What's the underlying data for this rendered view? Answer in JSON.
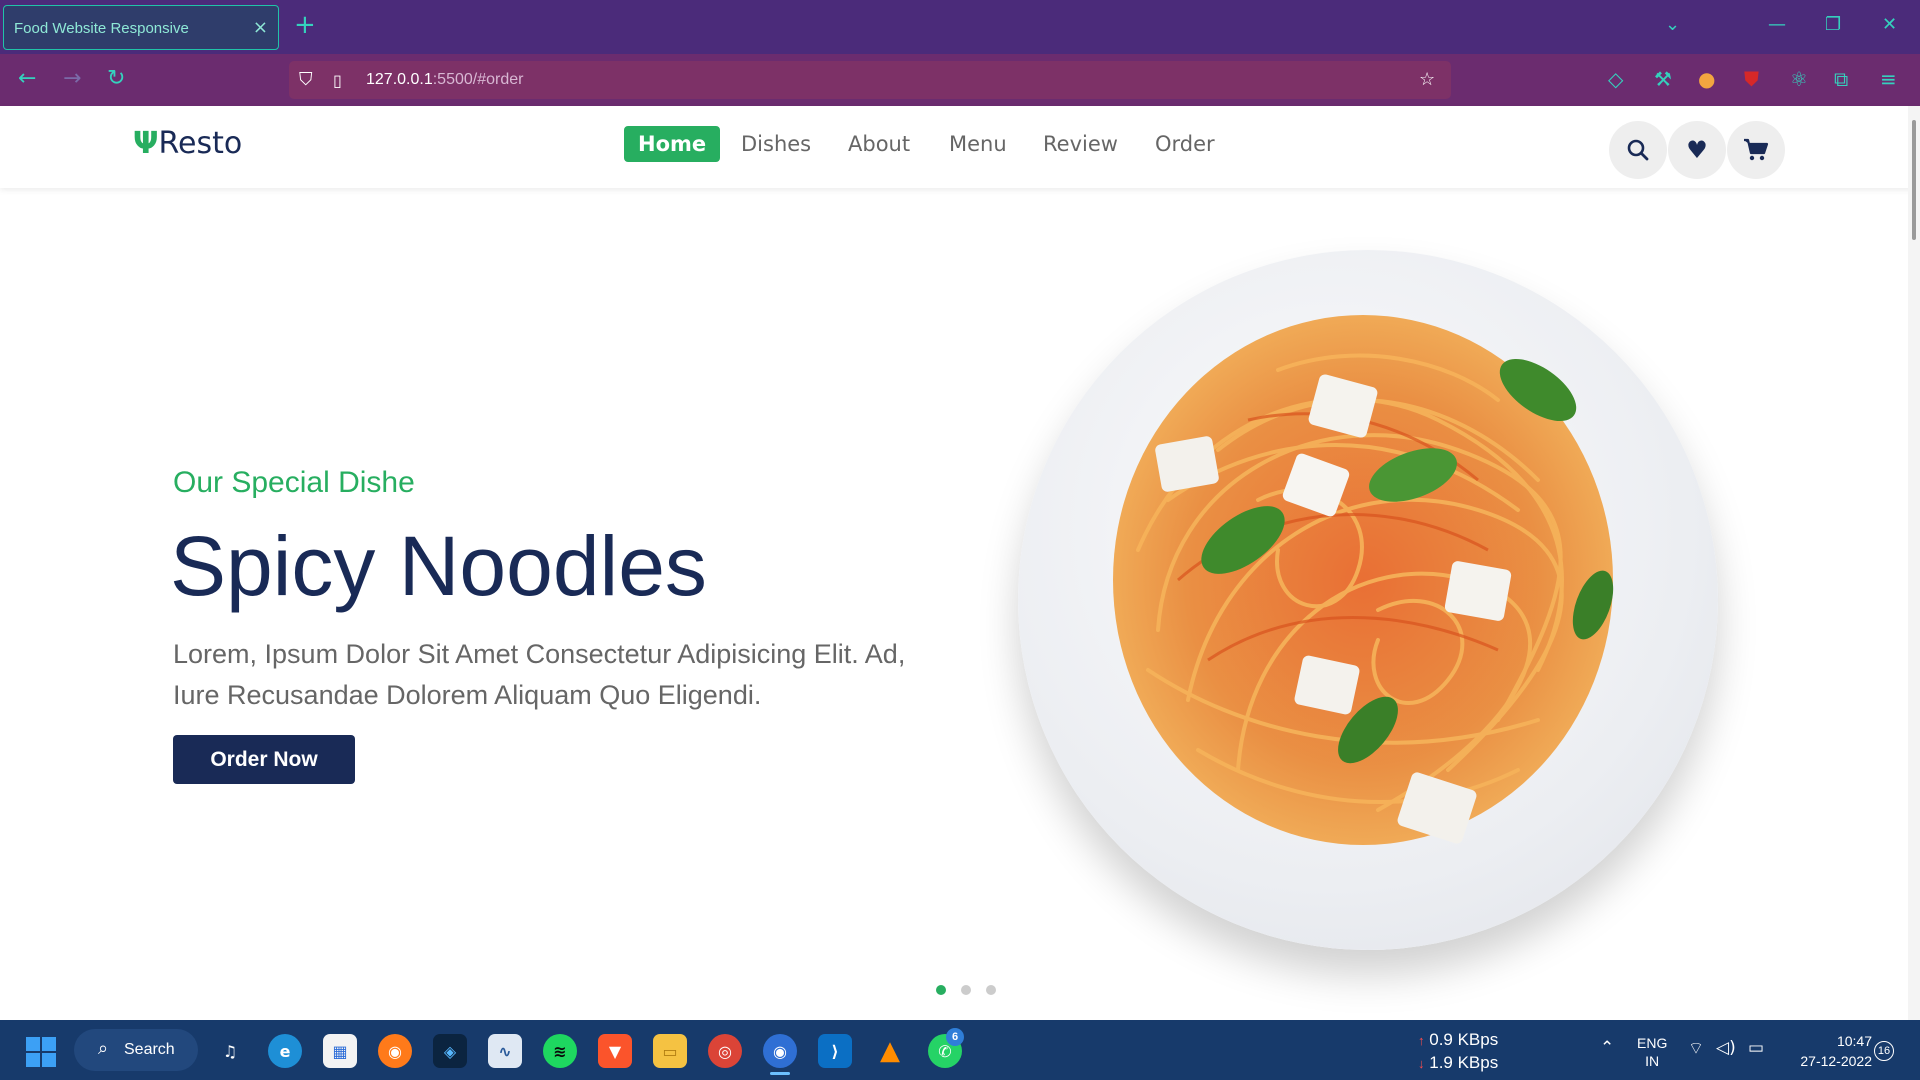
{
  "browser": {
    "tab_title": "Food Website Responsive",
    "tab_close": "×",
    "new_tab": "+",
    "url_host": "127.0.0.1",
    "url_rest": ":5500/#order",
    "window_controls": [
      "⌄",
      "—",
      "❐",
      "✕"
    ]
  },
  "site": {
    "logo_icon": "fork-knife-icon",
    "logo_text": "Resto",
    "nav": [
      {
        "label": "Home",
        "active": true
      },
      {
        "label": "Dishes",
        "active": false
      },
      {
        "label": "About",
        "active": false
      },
      {
        "label": "Menu",
        "active": false
      },
      {
        "label": "Review",
        "active": false
      },
      {
        "label": "Order",
        "active": false
      }
    ],
    "icons": [
      "search-icon",
      "heart-icon",
      "cart-icon"
    ]
  },
  "hero": {
    "subtitle": "Our Special Dishe",
    "title": "Spicy Noodles",
    "text_line1": "Lorem, Ipsum Dolor Sit Amet Consectetur Adipisicing Elit. Ad,",
    "text_line2": "Iure Recusandae Dolorem Aliquam Quo Eligendi.",
    "button": "Order Now",
    "slide_count": 3,
    "active_slide": 1
  },
  "taskbar": {
    "search_label": "Search",
    "apps": [
      "music-icon",
      "edge-icon",
      "store-icon",
      "firefox-icon",
      "dev-icon",
      "monitor-icon",
      "spotify-icon",
      "brave-icon",
      "folder-icon",
      "chrome-icon",
      "firefox-dev-icon",
      "vscode-icon",
      "vlc-icon",
      "whatsapp-icon"
    ],
    "whatsapp_badge": "6",
    "net_up": "0.9 KBps",
    "net_down": "1.9 KBps",
    "lang_top": "ENG",
    "lang_bottom": "IN",
    "time": "10:47",
    "date": "27-12-2022",
    "notifications": "16"
  },
  "colors": {
    "accent_green": "#27ae60",
    "brand_navy": "#192a56",
    "browser_purple": "#4b2b7a"
  }
}
